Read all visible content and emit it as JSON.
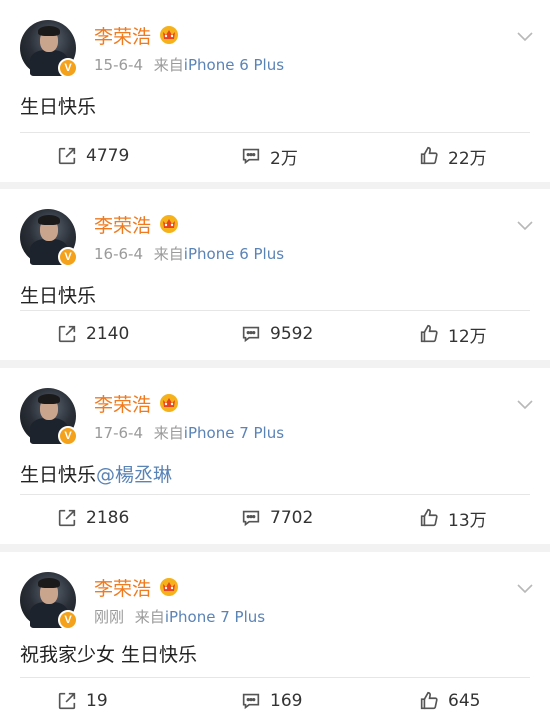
{
  "posts": [
    {
      "user": "李荣浩",
      "date": "15-6-4",
      "source_prefix": "来自",
      "source": "iPhone 6 Plus",
      "text": "生日快乐",
      "mention": "",
      "forward": "4779",
      "comment": "2万",
      "like": "22万"
    },
    {
      "user": "李荣浩",
      "date": "16-6-4",
      "source_prefix": "来自",
      "source": "iPhone 6 Plus",
      "text": "生日快乐",
      "mention": "",
      "forward": "2140",
      "comment": "9592",
      "like": "12万"
    },
    {
      "user": "李荣浩",
      "date": "17-6-4",
      "source_prefix": "来自",
      "source": "iPhone 7 Plus",
      "text": "生日快乐",
      "mention": "@楊丞琳",
      "forward": "2186",
      "comment": "7702",
      "like": "13万"
    },
    {
      "user": "李荣浩",
      "date": "刚刚",
      "source_prefix": "来自",
      "source": "iPhone 7 Plus",
      "text": "祝我家少女 生日快乐",
      "mention": "",
      "forward": "19",
      "comment": "169",
      "like": "645"
    }
  ],
  "badge": "V",
  "icons": {
    "forward": "forward-icon",
    "comment": "comment-icon",
    "like": "like-icon",
    "more": "chevron-down-icon",
    "vip": "crown-icon"
  },
  "colors": {
    "username": "#f07a1e",
    "link": "#5a83b6",
    "meta": "#9a9a9a",
    "badge": "#f4a11b"
  }
}
